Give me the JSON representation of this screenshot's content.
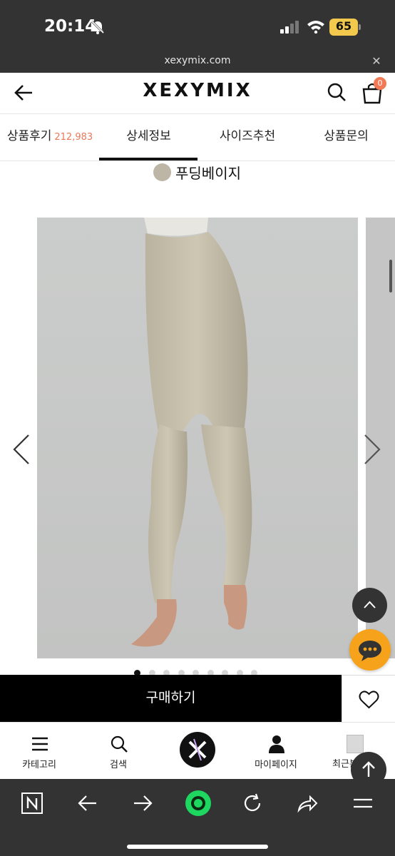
{
  "status_bar": {
    "time": "20:14",
    "battery": "65"
  },
  "browser": {
    "url": "xexymix.com",
    "close_label": "✕"
  },
  "header": {
    "brand": "XEXYMIX",
    "cart_count": "0"
  },
  "tabs": [
    {
      "label": "상품후기",
      "count": "212,983"
    },
    {
      "label": "상세정보"
    },
    {
      "label": "사이즈추천"
    },
    {
      "label": "상품문의"
    }
  ],
  "active_tab_index": 1,
  "product": {
    "color_name": "푸딩베이지",
    "color_hex": "#bdb6a7",
    "image_dots_total": 9,
    "image_dots_active_index": 0
  },
  "purchase": {
    "buy_label": "구매하기"
  },
  "bottom_nav": [
    {
      "label": "카테고리",
      "icon": "menu-icon"
    },
    {
      "label": "검색",
      "icon": "search-icon"
    },
    {
      "label": "",
      "icon": "brand-home-icon"
    },
    {
      "label": "마이페이지",
      "icon": "person-icon"
    },
    {
      "label": "최근본",
      "icon": "recent-thumbnail"
    }
  ],
  "colors": {
    "accent": "#e8795a",
    "chat": "#f7a21b",
    "dark_bar": "#333333"
  }
}
